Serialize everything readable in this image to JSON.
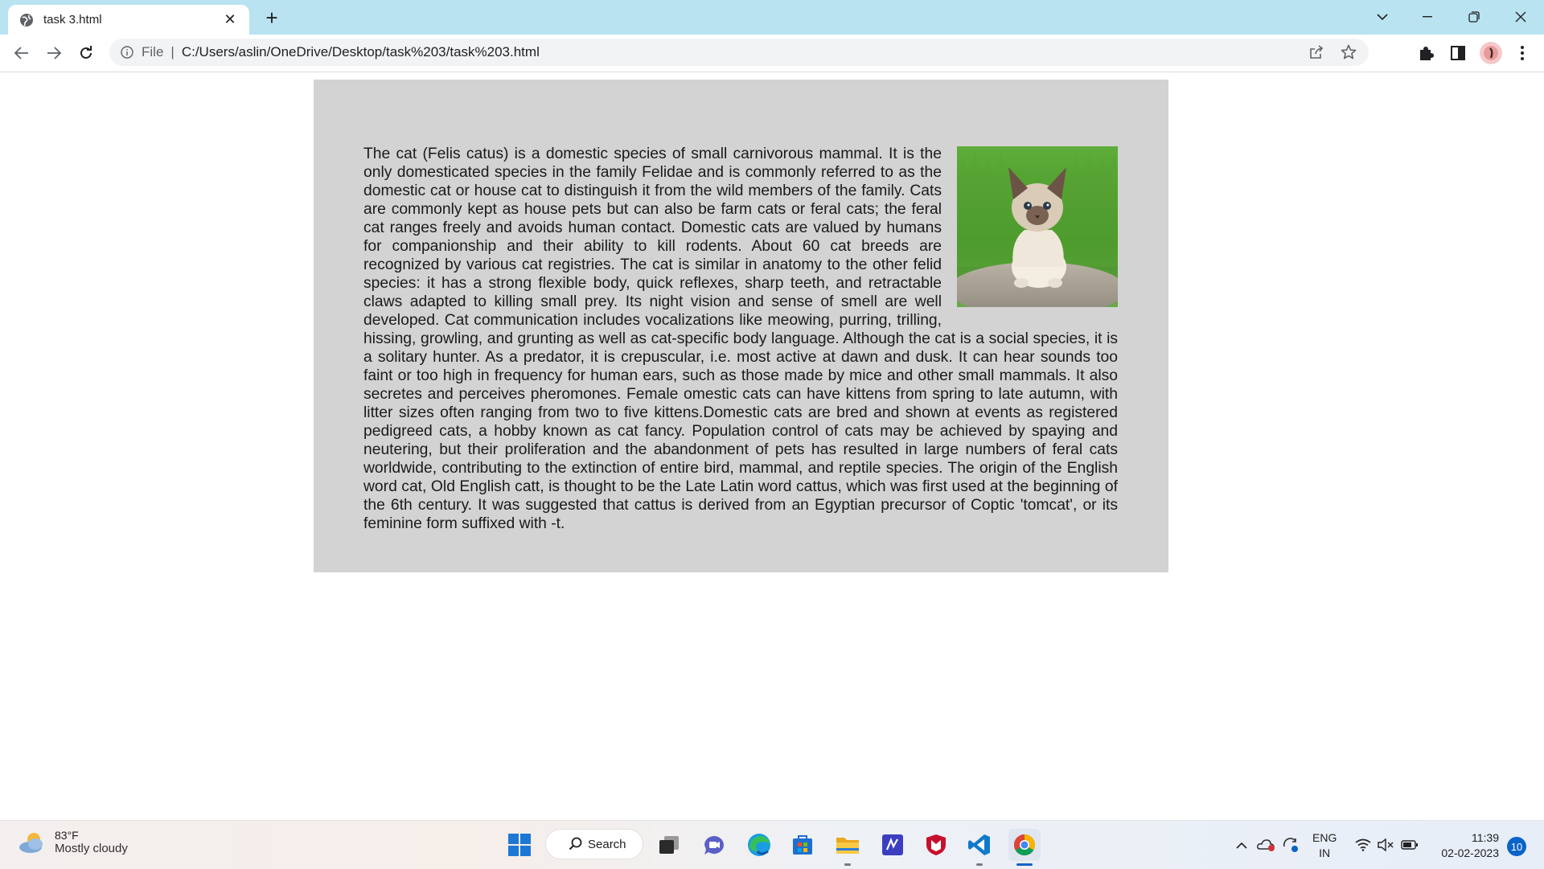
{
  "browser": {
    "tab_title": "task 3.html",
    "address_scheme": "File",
    "address_url": "C:/Users/aslin/OneDrive/Desktop/task%203/task%203.html"
  },
  "page": {
    "paragraph": "The cat (Felis catus) is a domestic species of small carnivorous mammal. It is the only domesticated species in the family Felidae and is commonly referred to as the domestic cat or house cat to distinguish it from the wild members of the family. Cats are commonly kept as house pets but can also be farm cats or feral cats; the feral cat ranges freely and avoids human contact. Domestic cats are valued by humans for companionship and their ability to kill rodents. About 60 cat breeds are recognized by various cat registries. The cat is similar in anatomy to the other felid species: it has a strong flexible body, quick reflexes, sharp teeth, and retractable claws adapted to killing small prey. Its night vision and sense of smell are well developed. Cat communication includes vocalizations like meowing, purring, trilling, hissing, growling, and grunting as well as cat-specific body language. Although the cat is a social species, it is a solitary hunter. As a predator, it is crepuscular, i.e. most active at dawn and dusk. It can hear sounds too faint or too high in frequency for human ears, such as those made by mice and other small mammals. It also secretes and perceives pheromones. Female omestic cats can have kittens from spring to late autumn, with litter sizes often ranging from two to five kittens.Domestic cats are bred and shown at events as registered pedigreed cats, a hobby known as cat fancy. Population control of cats may be achieved by spaying and neutering, but their proliferation and the abandonment of pets has resulted in large numbers of feral cats worldwide, contributing to the extinction of entire bird, mammal, and reptile species. The origin of the English word cat, Old English catt, is thought to be the Late Latin word cattus, which was first used at the beginning of the 6th century. It was suggested that cattus is derived from an Egyptian precursor of Coptic 'tomcat', or its feminine form suffixed with -t.",
    "background_color": "#d3d3d3"
  },
  "taskbar": {
    "weather_temp": "83°F",
    "weather_condition": "Mostly cloudy",
    "search_label": "Search",
    "lang_line1": "ENG",
    "lang_line2": "IN",
    "time": "11:39",
    "date": "02-02-2023",
    "notification_count": "10"
  },
  "colors": {
    "tabstrip": "#b9e3f1",
    "accent": "#0a64c8"
  }
}
